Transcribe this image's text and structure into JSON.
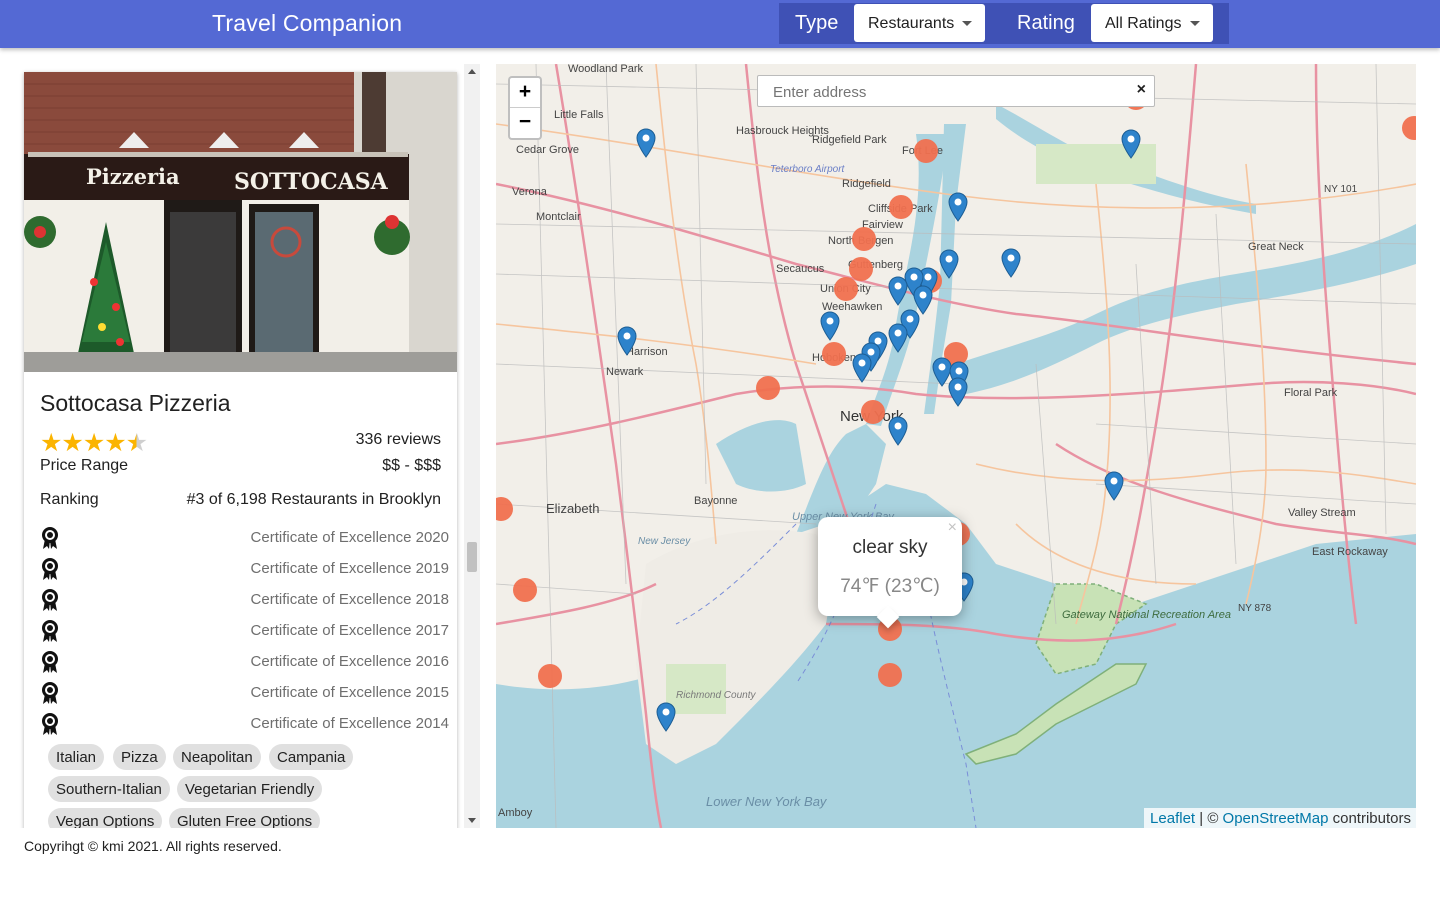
{
  "header": {
    "title": "Travel Companion",
    "type_label": "Type",
    "type_value": "Restaurants",
    "rating_label": "Rating",
    "rating_value": "All Ratings"
  },
  "place": {
    "name": "Sottocasa Pizzeria",
    "photo_sign_left": "Pizzeria",
    "photo_sign_right": "SOTTOCASA",
    "rating": 4.5,
    "stars": "★★★★",
    "half_star": "★",
    "reviews": "336 reviews",
    "price_label": "Price Range",
    "price_value": "$$ - $$$",
    "ranking_label": "Ranking",
    "ranking_value": "#3 of 6,198 Restaurants in Brooklyn",
    "awards": [
      "Certificate of Excellence 2020",
      "Certificate of Excellence 2019",
      "Certificate of Excellence 2018",
      "Certificate of Excellence 2017",
      "Certificate of Excellence 2016",
      "Certificate of Excellence 2015",
      "Certificate of Excellence 2014"
    ],
    "cuisines": [
      "Italian",
      "Pizza",
      "Neapolitan",
      "Campania",
      "Southern-Italian",
      "Vegetarian Friendly",
      "Vegan Options",
      "Gluten Free Options"
    ]
  },
  "map": {
    "zoom_in": "+",
    "zoom_out": "−",
    "search_placeholder": "Enter address",
    "search_clear": "×",
    "labels": [
      "Woodland Park",
      "Little Falls",
      "Cedar Grove",
      "Hasbrouck Heights",
      "Ridgefield Park",
      "Fort Lee",
      "Teterboro Airport",
      "Verona",
      "Montclair",
      "Ridgefield",
      "Cliffside Park",
      "Fairview",
      "North Bergen",
      "Secaucus",
      "Guttenberg",
      "Union City",
      "Weehawken",
      "Hoboken",
      "Harrison",
      "Newark",
      "New York",
      "Elizabeth",
      "Bayonne",
      "Upper New York Bay",
      "Great Neck",
      "Floral Park",
      "Valley Stream",
      "East Rockaway",
      "Gateway National Recreation Area",
      "Richmond County",
      "Lower New York Bay",
      "Amboy",
      "NY 101",
      "NY 878",
      "New Jersey"
    ],
    "attribution_leaflet": "Leaflet",
    "attribution_sep": " | © ",
    "attribution_osm": "OpenStreetMap",
    "attribution_rest": " contributors",
    "popup": {
      "close": "×",
      "description": "clear sky",
      "temperature": "74℉ (23℃)"
    },
    "colors": {
      "water": "#aad3df",
      "land": "#f2efe9",
      "park": "#c8e2b6",
      "road": "#e892a2",
      "marker_place": "#2e83cb",
      "marker_weather": "#f0704f"
    }
  },
  "footer": {
    "text": "Copyrihgt © kmi 2021. All rights reserved."
  }
}
